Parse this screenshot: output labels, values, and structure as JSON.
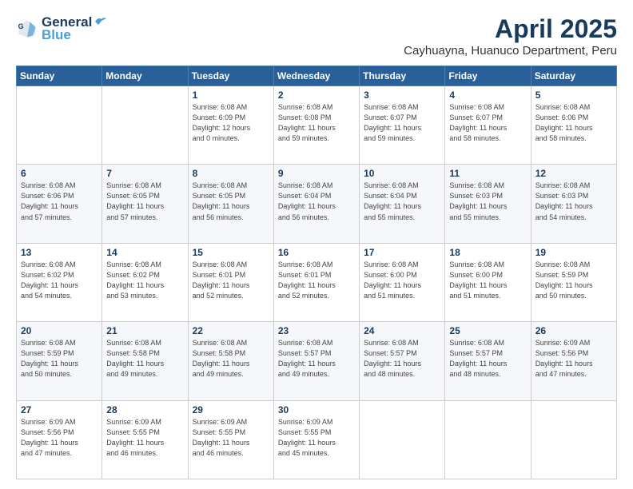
{
  "header": {
    "logo_line1": "General",
    "logo_line2": "Blue",
    "title": "April 2025",
    "subtitle": "Cayhuayna, Huanuco Department, Peru"
  },
  "weekdays": [
    "Sunday",
    "Monday",
    "Tuesday",
    "Wednesday",
    "Thursday",
    "Friday",
    "Saturday"
  ],
  "weeks": [
    [
      {
        "day": "",
        "info": ""
      },
      {
        "day": "",
        "info": ""
      },
      {
        "day": "1",
        "info": "Sunrise: 6:08 AM\nSunset: 6:09 PM\nDaylight: 12 hours\nand 0 minutes."
      },
      {
        "day": "2",
        "info": "Sunrise: 6:08 AM\nSunset: 6:08 PM\nDaylight: 11 hours\nand 59 minutes."
      },
      {
        "day": "3",
        "info": "Sunrise: 6:08 AM\nSunset: 6:07 PM\nDaylight: 11 hours\nand 59 minutes."
      },
      {
        "day": "4",
        "info": "Sunrise: 6:08 AM\nSunset: 6:07 PM\nDaylight: 11 hours\nand 58 minutes."
      },
      {
        "day": "5",
        "info": "Sunrise: 6:08 AM\nSunset: 6:06 PM\nDaylight: 11 hours\nand 58 minutes."
      }
    ],
    [
      {
        "day": "6",
        "info": "Sunrise: 6:08 AM\nSunset: 6:06 PM\nDaylight: 11 hours\nand 57 minutes."
      },
      {
        "day": "7",
        "info": "Sunrise: 6:08 AM\nSunset: 6:05 PM\nDaylight: 11 hours\nand 57 minutes."
      },
      {
        "day": "8",
        "info": "Sunrise: 6:08 AM\nSunset: 6:05 PM\nDaylight: 11 hours\nand 56 minutes."
      },
      {
        "day": "9",
        "info": "Sunrise: 6:08 AM\nSunset: 6:04 PM\nDaylight: 11 hours\nand 56 minutes."
      },
      {
        "day": "10",
        "info": "Sunrise: 6:08 AM\nSunset: 6:04 PM\nDaylight: 11 hours\nand 55 minutes."
      },
      {
        "day": "11",
        "info": "Sunrise: 6:08 AM\nSunset: 6:03 PM\nDaylight: 11 hours\nand 55 minutes."
      },
      {
        "day": "12",
        "info": "Sunrise: 6:08 AM\nSunset: 6:03 PM\nDaylight: 11 hours\nand 54 minutes."
      }
    ],
    [
      {
        "day": "13",
        "info": "Sunrise: 6:08 AM\nSunset: 6:02 PM\nDaylight: 11 hours\nand 54 minutes."
      },
      {
        "day": "14",
        "info": "Sunrise: 6:08 AM\nSunset: 6:02 PM\nDaylight: 11 hours\nand 53 minutes."
      },
      {
        "day": "15",
        "info": "Sunrise: 6:08 AM\nSunset: 6:01 PM\nDaylight: 11 hours\nand 52 minutes."
      },
      {
        "day": "16",
        "info": "Sunrise: 6:08 AM\nSunset: 6:01 PM\nDaylight: 11 hours\nand 52 minutes."
      },
      {
        "day": "17",
        "info": "Sunrise: 6:08 AM\nSunset: 6:00 PM\nDaylight: 11 hours\nand 51 minutes."
      },
      {
        "day": "18",
        "info": "Sunrise: 6:08 AM\nSunset: 6:00 PM\nDaylight: 11 hours\nand 51 minutes."
      },
      {
        "day": "19",
        "info": "Sunrise: 6:08 AM\nSunset: 5:59 PM\nDaylight: 11 hours\nand 50 minutes."
      }
    ],
    [
      {
        "day": "20",
        "info": "Sunrise: 6:08 AM\nSunset: 5:59 PM\nDaylight: 11 hours\nand 50 minutes."
      },
      {
        "day": "21",
        "info": "Sunrise: 6:08 AM\nSunset: 5:58 PM\nDaylight: 11 hours\nand 49 minutes."
      },
      {
        "day": "22",
        "info": "Sunrise: 6:08 AM\nSunset: 5:58 PM\nDaylight: 11 hours\nand 49 minutes."
      },
      {
        "day": "23",
        "info": "Sunrise: 6:08 AM\nSunset: 5:57 PM\nDaylight: 11 hours\nand 49 minutes."
      },
      {
        "day": "24",
        "info": "Sunrise: 6:08 AM\nSunset: 5:57 PM\nDaylight: 11 hours\nand 48 minutes."
      },
      {
        "day": "25",
        "info": "Sunrise: 6:08 AM\nSunset: 5:57 PM\nDaylight: 11 hours\nand 48 minutes."
      },
      {
        "day": "26",
        "info": "Sunrise: 6:09 AM\nSunset: 5:56 PM\nDaylight: 11 hours\nand 47 minutes."
      }
    ],
    [
      {
        "day": "27",
        "info": "Sunrise: 6:09 AM\nSunset: 5:56 PM\nDaylight: 11 hours\nand 47 minutes."
      },
      {
        "day": "28",
        "info": "Sunrise: 6:09 AM\nSunset: 5:55 PM\nDaylight: 11 hours\nand 46 minutes."
      },
      {
        "day": "29",
        "info": "Sunrise: 6:09 AM\nSunset: 5:55 PM\nDaylight: 11 hours\nand 46 minutes."
      },
      {
        "day": "30",
        "info": "Sunrise: 6:09 AM\nSunset: 5:55 PM\nDaylight: 11 hours\nand 45 minutes."
      },
      {
        "day": "",
        "info": ""
      },
      {
        "day": "",
        "info": ""
      },
      {
        "day": "",
        "info": ""
      }
    ]
  ]
}
